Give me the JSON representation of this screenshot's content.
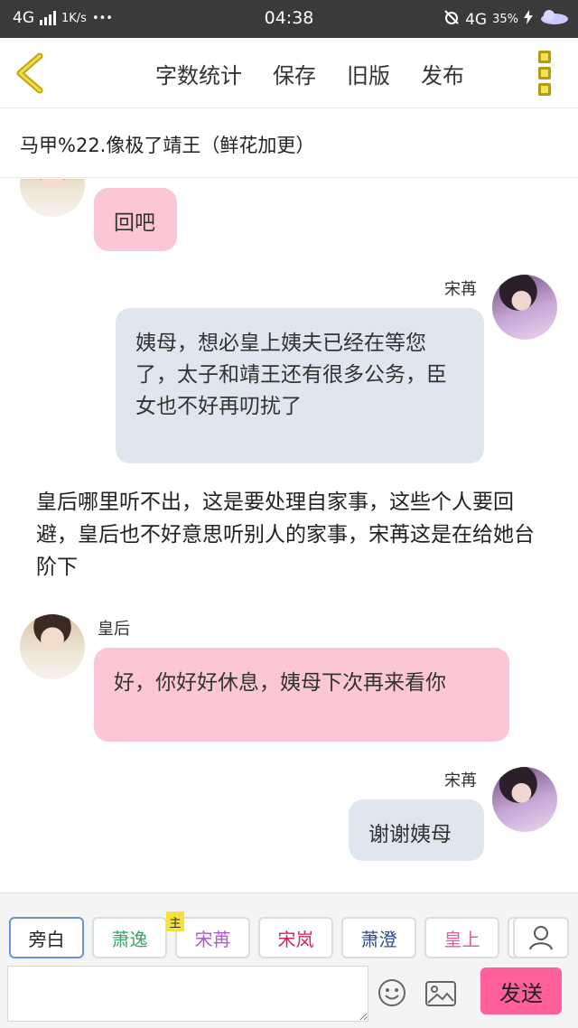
{
  "status_bar": {
    "network": "4G",
    "speed": "1K/s",
    "dots": "•••",
    "time": "04:38",
    "network_right": "4G",
    "battery": "35%"
  },
  "toolbar": {
    "word_count": "字数统计",
    "save": "保存",
    "old_version": "旧版",
    "publish": "发布"
  },
  "story_title": "马甲%22.像极了靖王（鲜花加更）",
  "messages": {
    "m1": {
      "text": "回吧"
    },
    "m2": {
      "name": "宋苒",
      "text": "姨母，想必皇上姨夫已经在等您了，太子和靖王还有很多公务，臣女也不好再叨扰了"
    },
    "narration": "皇后哪里听不出，这是要处理自家事，这些个人要回避，皇后也不好意思听别人的家事，宋苒这是在给她台阶下",
    "m3": {
      "name": "皇后",
      "text": "好，你好好休息，姨母下次再来看你"
    },
    "m4": {
      "name": "宋苒",
      "text": "谢谢姨母"
    }
  },
  "characters": {
    "c0": "旁白",
    "c1": "萧逸",
    "c2": "宋苒",
    "c2_tag": "主",
    "c3": "宋岚",
    "c4": "萧澄",
    "c5": "皇上"
  },
  "character_colors": {
    "c1": "#3aa46a",
    "c2": "#b05ad6",
    "c3": "#d1245f",
    "c4": "#2a4c8f",
    "c5": "#e85a9a"
  },
  "input": {
    "placeholder": ""
  },
  "send_label": "发送",
  "colors": {
    "pink_bubble": "#fbc7d4",
    "blue_bubble": "#dfe6ef",
    "send_button": "#ff5f9a",
    "menu_icon": "#f7e15a"
  }
}
